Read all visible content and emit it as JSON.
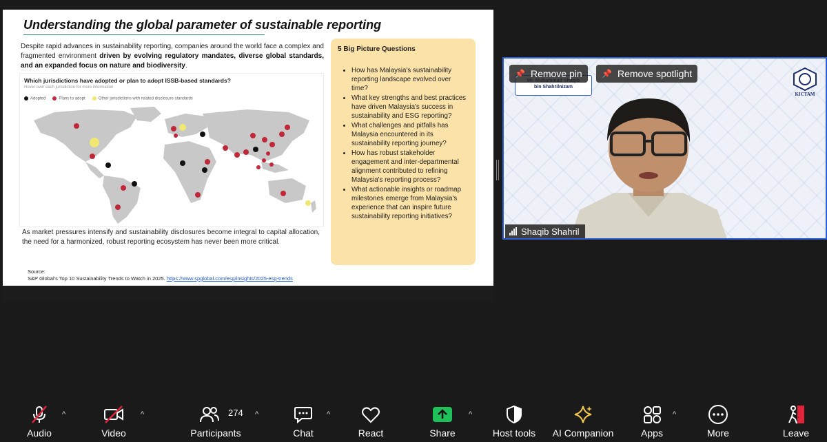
{
  "slide": {
    "title": "Understanding the global parameter of sustainable reporting",
    "intro_plain": "Despite rapid advances in sustainability reporting, companies around the world face a complex and fragmented environment ",
    "intro_bold": "driven by evolving regulatory mandates, diverse global standards, and an expanded focus on nature and biodiversity",
    "intro_end": ".",
    "map_title": "Which jurisdictions have adopted or plan to adopt ISSB-based standards?",
    "map_subtitle": "Hover over each jurisdiction for more information",
    "legend": [
      {
        "label": "Adopted",
        "color": "#111111"
      },
      {
        "label": "Plans to adopt",
        "color": "#c0283a"
      },
      {
        "label": "Other jurisdictions with related disclosure standards",
        "color": "#f0e870"
      }
    ],
    "outro": "As market pressures intensify and sustainability disclosures become integral to capital allocation, the need for a harmonized, robust reporting ecosystem has never been more critical.",
    "source_label": "Source:",
    "source_text": "S&P Global's Top 10 Sustainability Trends to Watch in 2025.",
    "source_link": "https://www.spglobal.com/esg/insights/2025-esg-trends",
    "questions_title": "5 Big Picture Questions",
    "questions": [
      "How has Malaysia's sustainability reporting landscape evolved over time?",
      "What key strengths and best practices have driven Malaysia's success in sustainability and ESG reporting?",
      "What challenges and pitfalls has Malaysia encountered in its sustainability reporting journey?",
      "How has robust stakeholder engagement and inter-departmental alignment contributed to refining Malaysia's reporting process?",
      "What actionable insights or roadmap milestones emerge from Malaysia's experience that can inspire future sustainability reporting initiatives?"
    ]
  },
  "video": {
    "remove_pin": "Remove pin",
    "remove_spotlight": "Remove spotlight",
    "name_card_line1": "Mr. Muhammad Shaqib",
    "name_card_line2": "bin Shahrilnizam",
    "logo_text": "KICTAM",
    "participant_name": "Shaqib Shahril",
    "accent": "#2d5fd8"
  },
  "toolbar": {
    "audio": "Audio",
    "video": "Video",
    "participants": "Participants",
    "participants_count": "274",
    "chat": "Chat",
    "react": "React",
    "share": "Share",
    "host_tools": "Host tools",
    "ai_companion": "AI Companion",
    "apps": "Apps",
    "more": "More",
    "leave": "Leave",
    "share_color": "#1fbf5a",
    "leave_color": "#e0243a"
  }
}
